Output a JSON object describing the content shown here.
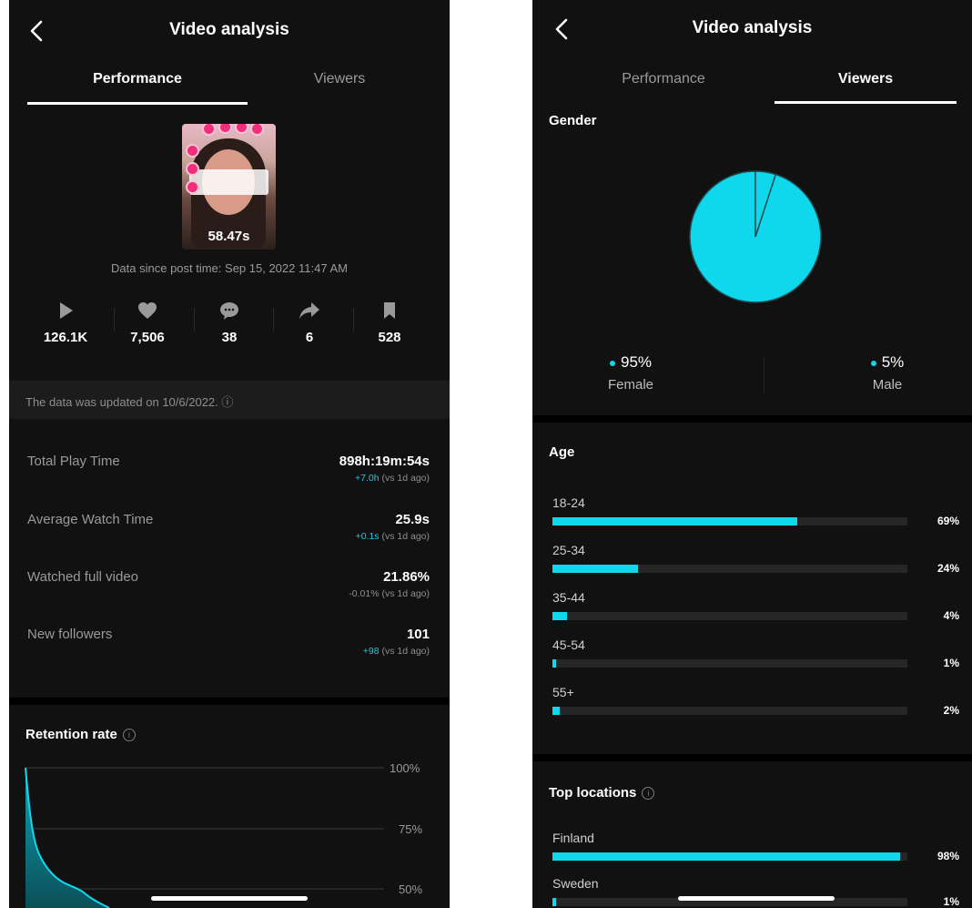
{
  "left": {
    "title": "Video analysis",
    "tabs": [
      {
        "label": "Performance"
      },
      {
        "label": "Viewers"
      }
    ],
    "thumbnail": {
      "duration": "58.47s"
    },
    "data_since": "Data since post time: Sep 15, 2022 11:47 AM",
    "stats": [
      {
        "icon": "play-icon",
        "value": "126.1K"
      },
      {
        "icon": "heart-icon",
        "value": "7,506"
      },
      {
        "icon": "comment-icon",
        "value": "38"
      },
      {
        "icon": "share-icon",
        "value": "6"
      },
      {
        "icon": "bookmark-icon",
        "value": "528"
      }
    ],
    "notice": "The data was updated on 10/6/2022. ⓘ",
    "metrics": [
      {
        "label": "Total Play Time",
        "value": "898h:19m:54s",
        "delta": "+7.0h",
        "delta_suffix": " (vs 1d ago)"
      },
      {
        "label": "Average Watch Time",
        "value": "25.9s",
        "delta": "+0.1s",
        "delta_suffix": " (vs 1d ago)"
      },
      {
        "label": "Watched full video",
        "value": "21.86%",
        "delta": "-0.01%",
        "delta_suffix": " (vs 1d ago)"
      },
      {
        "label": "New followers",
        "value": "101",
        "delta": "+98",
        "delta_suffix": " (vs 1d ago)"
      }
    ],
    "retention": {
      "title": "Retention rate",
      "info": "i",
      "ticks": [
        "100%",
        "75%",
        "50%"
      ]
    }
  },
  "right": {
    "title": "Video analysis",
    "tabs": [
      {
        "label": "Performance"
      },
      {
        "label": "Viewers"
      }
    ],
    "gender": {
      "title": "Gender",
      "items": [
        {
          "pct": "95%",
          "label": "Female",
          "value": 95
        },
        {
          "pct": "5%",
          "label": "Male",
          "value": 5
        }
      ]
    },
    "age": {
      "title": "Age",
      "rows": [
        {
          "label": "18-24",
          "pct": "69%",
          "value": 69
        },
        {
          "label": "25-34",
          "pct": "24%",
          "value": 24
        },
        {
          "label": "35-44",
          "pct": "4%",
          "value": 4
        },
        {
          "label": "45-54",
          "pct": "1%",
          "value": 1
        },
        {
          "label": "55+",
          "pct": "2%",
          "value": 2
        }
      ]
    },
    "locations": {
      "title": "Top locations",
      "info": "i",
      "rows": [
        {
          "label": "Finland",
          "pct": "98%",
          "value": 98
        },
        {
          "label": "Sweden",
          "pct": "1%",
          "value": 1
        }
      ]
    }
  },
  "colors": {
    "accent": "#10d8ec",
    "background": "#111111",
    "muted": "#9a9a9a",
    "positive": "#25c7e0"
  }
}
